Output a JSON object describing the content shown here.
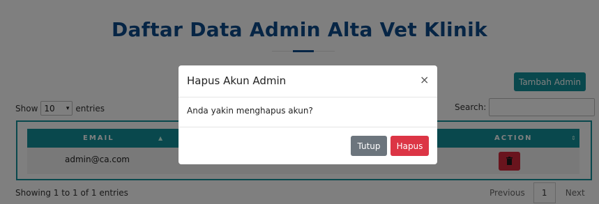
{
  "page": {
    "title": "Daftar Data Admin Alta Vet Klinik",
    "add_button": "Tambah Admin"
  },
  "controls": {
    "show_label": "Show",
    "length_value": "10",
    "entries_label": "entries",
    "search_label": "Search:",
    "search_value": ""
  },
  "table": {
    "columns": [
      "EMAIL",
      "ACTION"
    ],
    "rows": [
      {
        "email": "admin@ca.com"
      }
    ]
  },
  "footer": {
    "info": "Showing 1 to 1 of 1 entries",
    "previous": "Previous",
    "page": "1",
    "next": "Next"
  },
  "modal": {
    "title": "Hapus Akun Admin",
    "close": "×",
    "message": "Anda yakin menghapus akun?",
    "cancel_label": "Tutup",
    "confirm_label": "Hapus"
  },
  "colors": {
    "accent": "#13909a",
    "title": "#0c4a8a",
    "danger": "#dc3545",
    "secondary": "#6c757d"
  },
  "icons": {
    "delete": "trash-icon",
    "length_select": "chevron-down-icon",
    "sort_email": "sort-up-icon",
    "sort_action": "sort-icon"
  }
}
